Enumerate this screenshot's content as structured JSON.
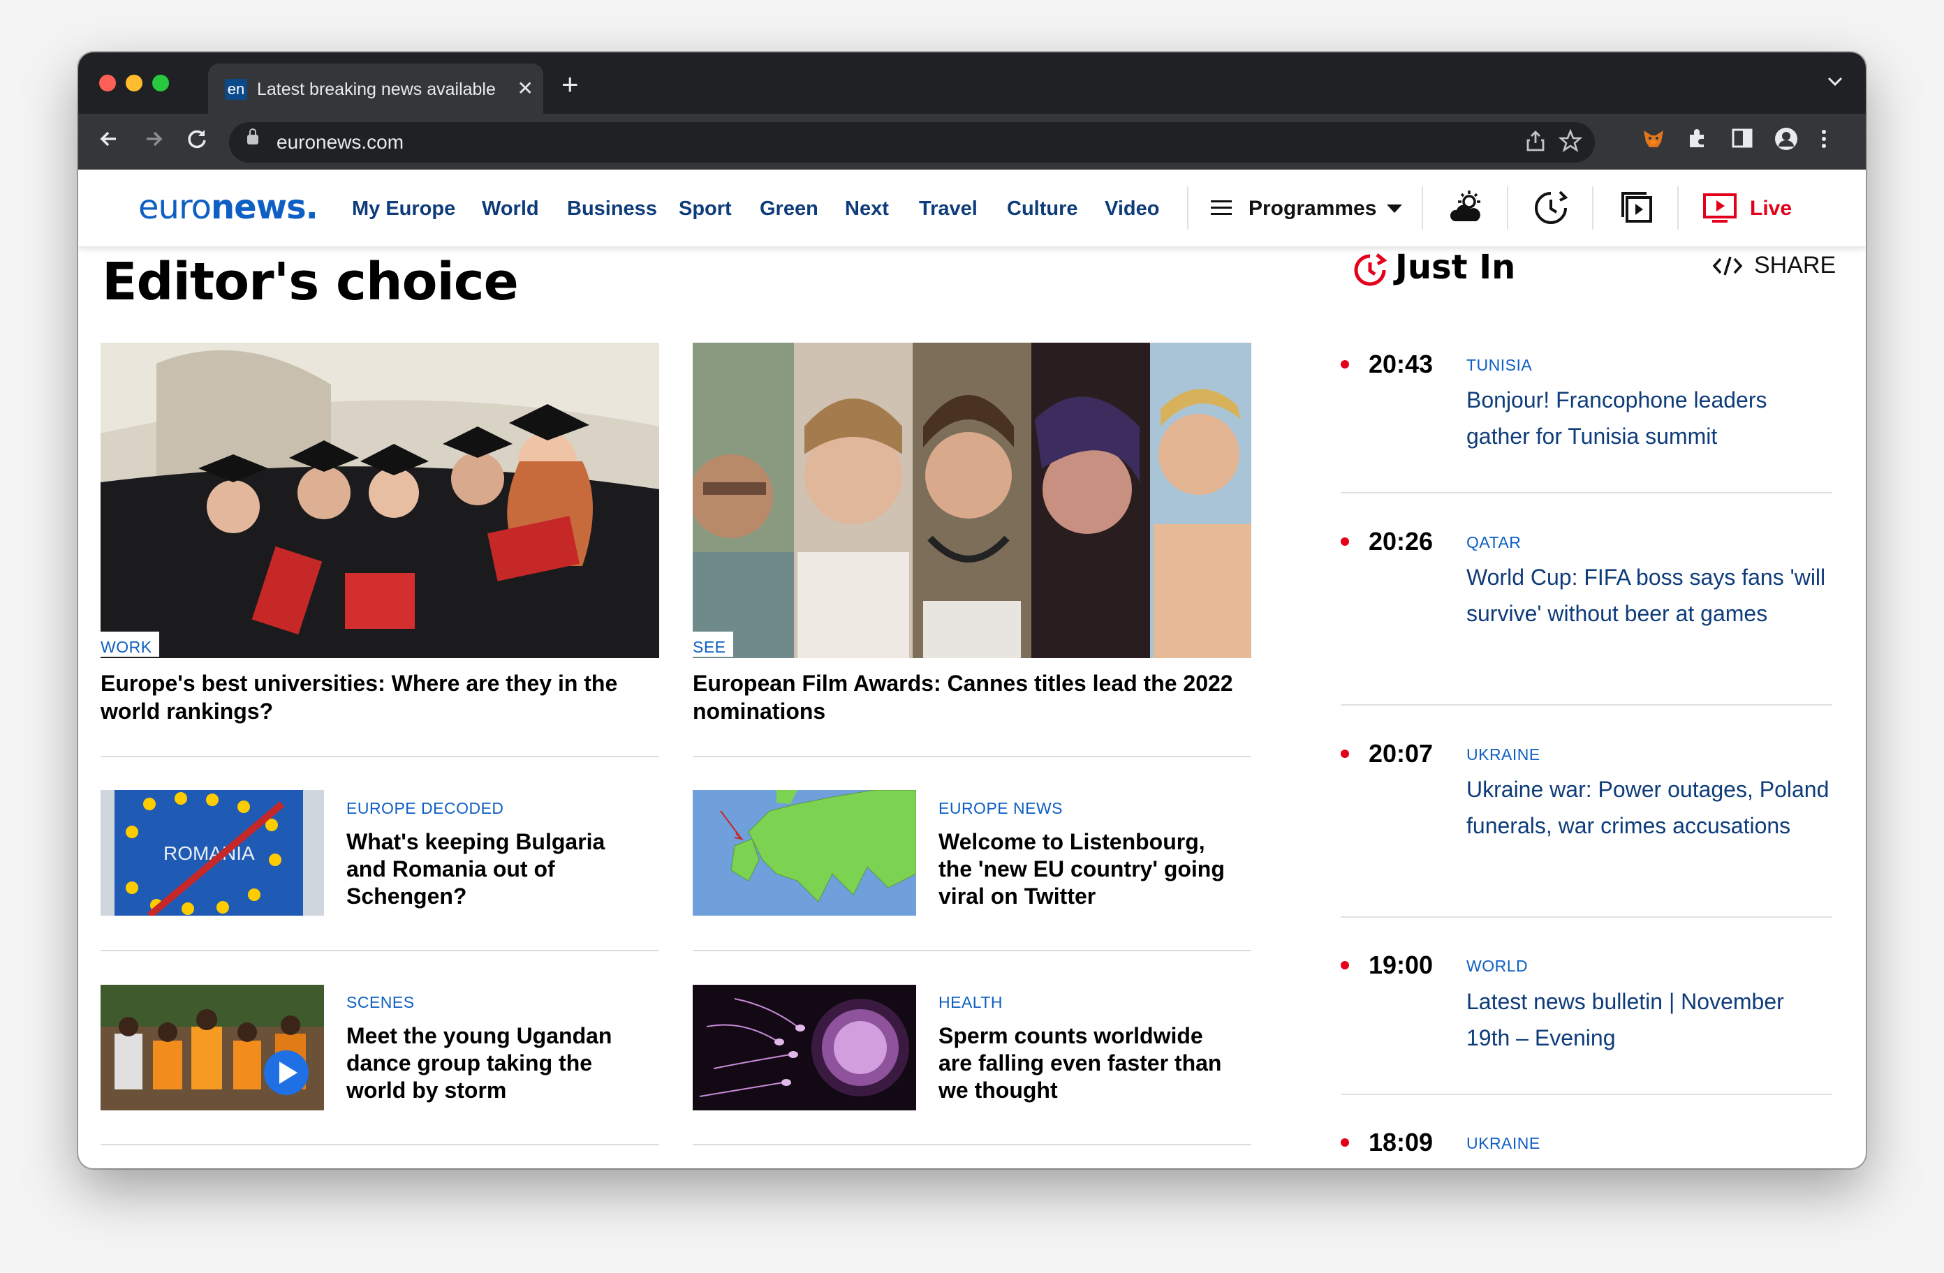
{
  "browser": {
    "tab_favicon": "en",
    "tab_title": "Latest breaking news available",
    "url": "euronews.com"
  },
  "site": {
    "logo_text": "euro",
    "logo_bold": "news.",
    "nav": [
      "My Europe",
      "World",
      "Business",
      "Sport",
      "Green",
      "Next",
      "Travel",
      "Culture",
      "Video"
    ],
    "programmes_label": "Programmes",
    "live_label": "Live"
  },
  "editors_choice": {
    "heading": "Editor's choice",
    "hero": [
      {
        "tag": "WORK",
        "title": "Europe's best universities: Where are they in the world rankings?"
      },
      {
        "tag": "SEE",
        "title": "European Film Awards: Cannes titles lead the 2022 nominations"
      }
    ],
    "small": [
      {
        "tag": "EUROPE DECODED",
        "title": "What's keeping Bulgaria and Romania out of Schengen?",
        "thumb_text": "ROMANIA"
      },
      {
        "tag": "EUROPE NEWS",
        "title": "Welcome to Listenbourg, the 'new EU country' going viral on Twitter"
      },
      {
        "tag": "SCENES",
        "title": "Meet the young Ugandan dance group taking the world by storm"
      },
      {
        "tag": "HEALTH",
        "title": "Sperm counts worldwide are falling even faster than we thought"
      }
    ]
  },
  "just_in": {
    "heading": "Just In",
    "share_label": "SHARE",
    "items": [
      {
        "time": "20:43",
        "tag": "TUNISIA",
        "text": "Bonjour! Francophone leaders gather for Tunisia summit"
      },
      {
        "time": "20:26",
        "tag": "QATAR",
        "text": "World Cup: FIFA boss says fans 'will survive' without beer at games"
      },
      {
        "time": "20:07",
        "tag": "UKRAINE",
        "text": "Ukraine war: Power outages, Poland funerals, war crimes accusations"
      },
      {
        "time": "19:00",
        "tag": "WORLD",
        "text": "Latest news bulletin | November 19th – Evening"
      },
      {
        "time": "18:09",
        "tag": "UKRAINE",
        "text": ""
      }
    ]
  },
  "colors": {
    "brand_blue": "#0e5fc3",
    "nav_navy": "#0e3c7a",
    "live_red": "#e4001b"
  }
}
